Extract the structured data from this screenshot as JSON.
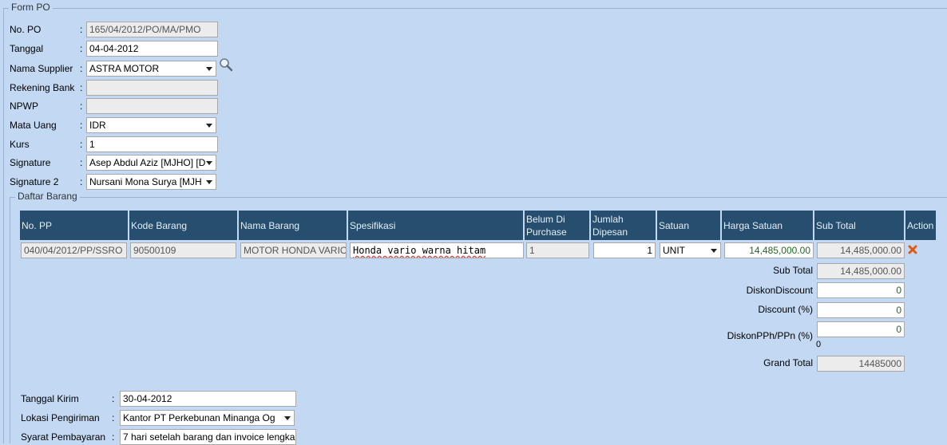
{
  "form": {
    "legend": "Form PO",
    "no_po": {
      "label": "No. PO",
      "value": "165/04/2012/PO/MA/PMO"
    },
    "tanggal": {
      "label": "Tanggal",
      "value": "04-04-2012"
    },
    "supplier": {
      "label": "Nama Supplier",
      "value": "ASTRA MOTOR"
    },
    "rekening": {
      "label": "Rekening Bank",
      "value": ""
    },
    "npwp": {
      "label": "NPWP",
      "value": ""
    },
    "mata_uang": {
      "label": "Mata Uang",
      "value": "IDR"
    },
    "kurs": {
      "label": "Kurs",
      "value": "1"
    },
    "signature": {
      "label": "Signature",
      "value": "Asep Abdul Aziz [MJHO] [D"
    },
    "signature2": {
      "label": "Signature 2",
      "value": "Nursani Mona Surya [MJH"
    },
    "colon": ":"
  },
  "daftar": {
    "legend": "Daftar Barang",
    "headers": [
      "No. PP",
      "Kode Barang",
      "Nama Barang",
      "Spesifikasi",
      "Belum Di Purchase",
      "Jumlah Dipesan",
      "Satuan",
      "Harga Satuan",
      "Sub Total",
      "Action"
    ],
    "rows": [
      {
        "no_pp": "040/04/2012/PP/SSRO",
        "kode": "90500109",
        "nama": "MOTOR HONDA VARIO",
        "spesifikasi": "Honda vario warna hitam",
        "belum": "1",
        "jumlah": "1",
        "satuan": "UNIT",
        "harga": "14,485,000.00",
        "subtotal": "14,485,000.00"
      }
    ],
    "summary": {
      "subtotal_label": "Sub Total",
      "subtotal": "14,485,000.00",
      "diskon_label": "DiskonDiscount",
      "diskon": "0",
      "discount_pct_label": "Discount (%)",
      "discount_pct": "0",
      "pph_label": "DiskonPPh/PPn (%)",
      "pph": "0",
      "pph_note": "0",
      "grand_label": "Grand Total",
      "grand": "14485000"
    }
  },
  "bottom": {
    "tanggal_kirim": {
      "label": "Tanggal Kirim",
      "value": "30-04-2012"
    },
    "lokasi": {
      "label": "Lokasi Pengiriman",
      "value": "Kantor PT Perkebunan Minanga Og"
    },
    "syarat": {
      "label": "Syarat Pembayaran",
      "value": "7 hari setelah barang dan invoice lengka"
    }
  },
  "colors": {
    "header_bg": "#254e6f",
    "page_bg": "#c3d8f2",
    "delete_icon": "#e05a14"
  },
  "icons": {
    "lookup": "magnifier-icon",
    "delete": "delete-x-icon",
    "dropdown": "chevron-down-icon"
  }
}
